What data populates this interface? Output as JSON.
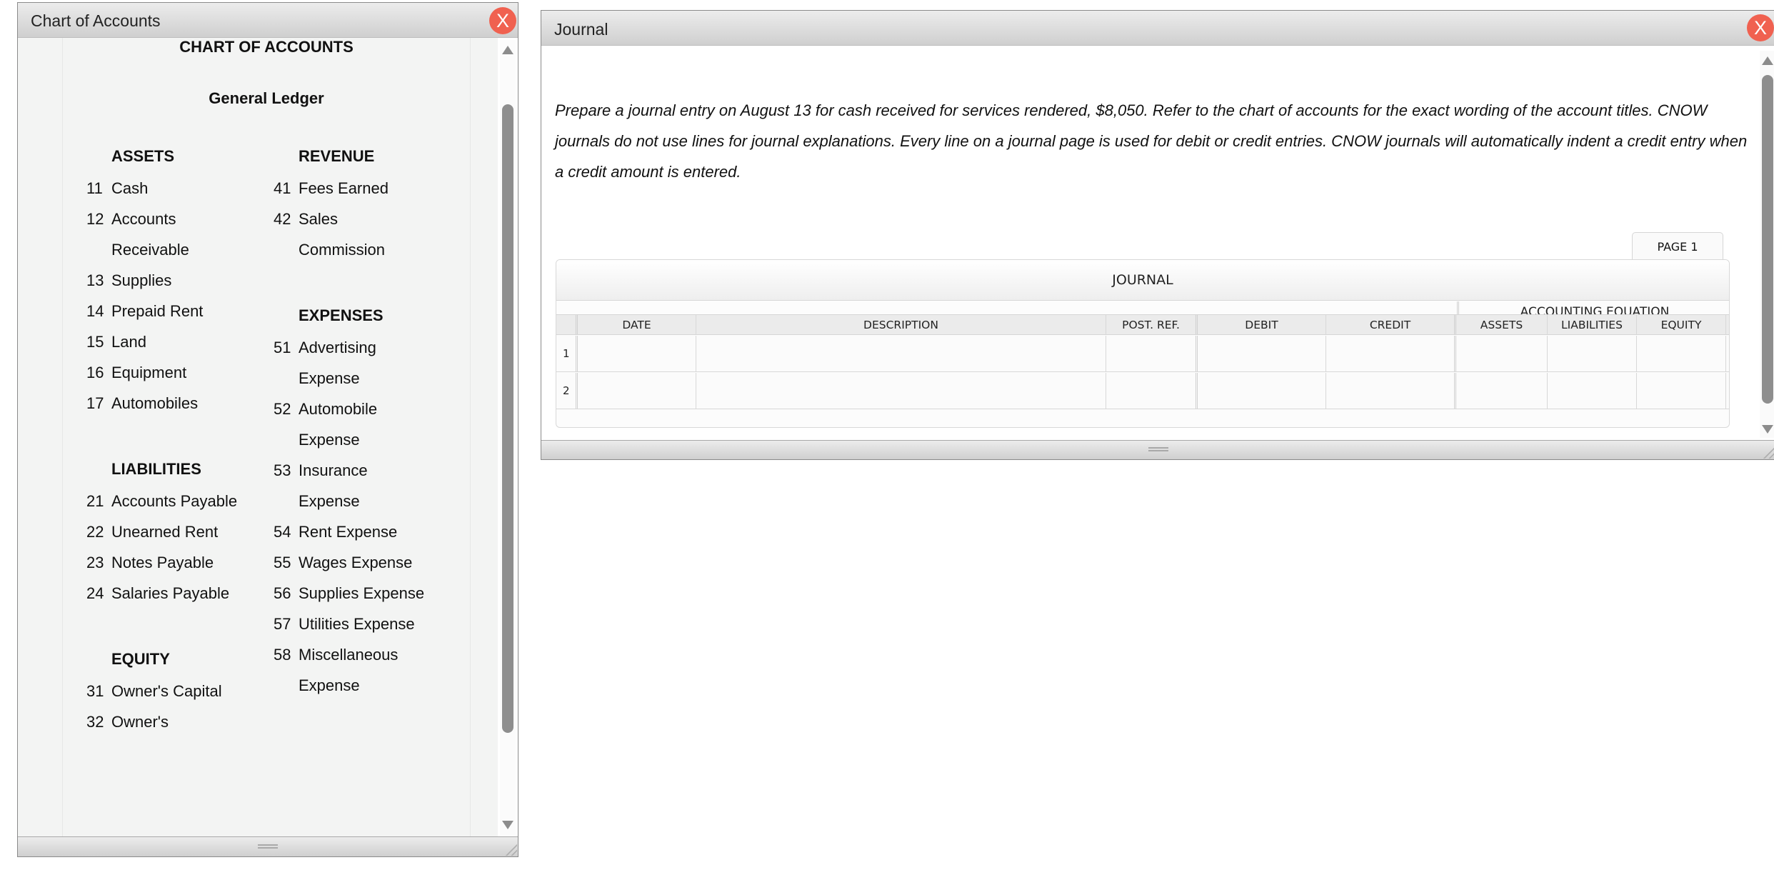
{
  "chart_of_accounts_window": {
    "title": "Chart of Accounts",
    "close_label": "X",
    "heading": "CHART OF ACCOUNTS",
    "subheading": "General Ledger",
    "sections": {
      "assets": {
        "heading": "ASSETS",
        "accounts": [
          {
            "num": "11",
            "name": "Cash"
          },
          {
            "num": "12",
            "name": "Accounts Receivable"
          },
          {
            "num": "13",
            "name": "Supplies"
          },
          {
            "num": "14",
            "name": "Prepaid Rent"
          },
          {
            "num": "15",
            "name": "Land"
          },
          {
            "num": "16",
            "name": "Equipment"
          },
          {
            "num": "17",
            "name": "Automobiles"
          }
        ]
      },
      "liabilities": {
        "heading": "LIABILITIES",
        "accounts": [
          {
            "num": "21",
            "name": "Accounts Payable"
          },
          {
            "num": "22",
            "name": "Unearned Rent"
          },
          {
            "num": "23",
            "name": "Notes Payable"
          },
          {
            "num": "24",
            "name": "Salaries Payable"
          }
        ]
      },
      "equity": {
        "heading": "EQUITY",
        "accounts": [
          {
            "num": "31",
            "name": "Owner's Capital"
          },
          {
            "num": "32",
            "name": "Owner's"
          }
        ]
      },
      "revenue": {
        "heading": "REVENUE",
        "accounts": [
          {
            "num": "41",
            "name": "Fees Earned"
          },
          {
            "num": "42",
            "name": "Sales Commission"
          }
        ]
      },
      "expenses": {
        "heading": "EXPENSES",
        "accounts": [
          {
            "num": "51",
            "name": "Advertising Expense"
          },
          {
            "num": "52",
            "name": "Automobile Expense"
          },
          {
            "num": "53",
            "name": "Insurance Expense"
          },
          {
            "num": "54",
            "name": "Rent Expense"
          },
          {
            "num": "55",
            "name": "Wages Expense"
          },
          {
            "num": "56",
            "name": "Supplies Expense"
          },
          {
            "num": "57",
            "name": "Utilities Expense"
          },
          {
            "num": "58",
            "name": "Miscellaneous Expense"
          }
        ]
      }
    }
  },
  "journal_window": {
    "title": "Journal",
    "close_label": "X",
    "instructions": "Prepare a journal entry on August 13 for cash received for services rendered, $8,050. Refer to the chart of accounts for the exact wording of the account titles. CNOW journals do not use lines for journal explanations. Every line on a journal page is used for debit or credit entries. CNOW journals will automatically indent a credit entry when a credit amount is entered.",
    "page_tab": "PAGE 1",
    "table": {
      "title": "JOURNAL",
      "group_label": "ACCOUNTING EQUATION",
      "columns": [
        "DATE",
        "DESCRIPTION",
        "POST. REF.",
        "DEBIT",
        "CREDIT",
        "ASSETS",
        "LIABILITIES",
        "EQUITY"
      ],
      "rows": [
        {
          "num": "1",
          "date": "",
          "description": "",
          "post_ref": "",
          "debit": "",
          "credit": "",
          "assets": "",
          "liabilities": "",
          "equity": ""
        },
        {
          "num": "2",
          "date": "",
          "description": "",
          "post_ref": "",
          "debit": "",
          "credit": "",
          "assets": "",
          "liabilities": "",
          "equity": ""
        }
      ]
    }
  }
}
